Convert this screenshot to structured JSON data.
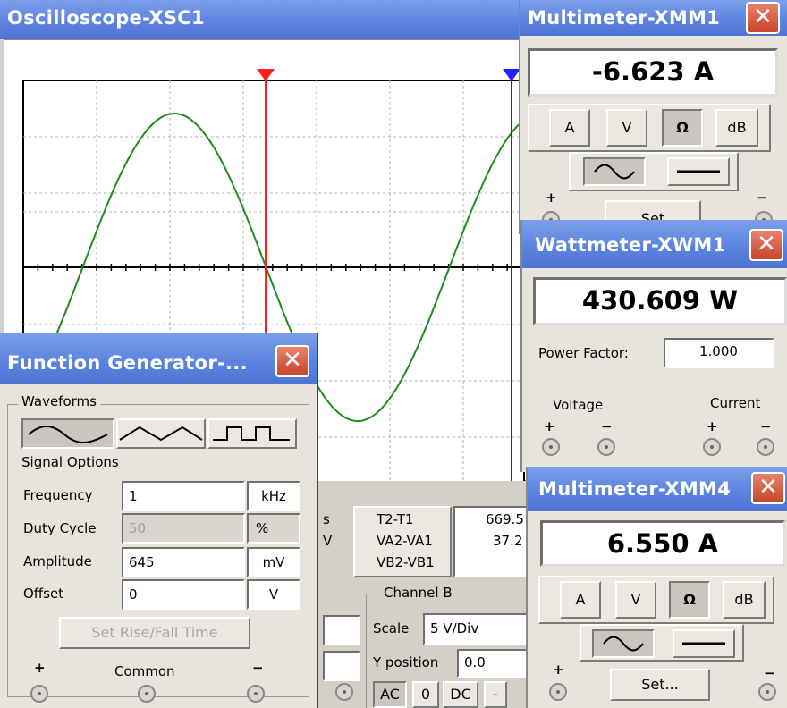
{
  "oscilloscope": {
    "title": "Oscilloscope-XSC1",
    "t2t1": {
      "label1": "T2-T1",
      "label2": "VA2-VA1",
      "label3": "VB2-VB1",
      "value1": "669.5",
      "value2": "37.2"
    },
    "partial": {
      "s": "s",
      "v": "V"
    },
    "channel_b": {
      "title": "Channel B",
      "scale_label": "Scale",
      "scale_value": "5 V/Div",
      "ypos_label": "Y position",
      "ypos_value": "0.0",
      "coupling": [
        "AC",
        "0",
        "DC",
        "-"
      ]
    }
  },
  "function_generator": {
    "title": "Function Generator-...",
    "waveforms_label": "Waveforms",
    "signal_options_label": "Signal Options",
    "frequency": {
      "label": "Frequency",
      "value": "1",
      "unit": "kHz"
    },
    "duty_cycle": {
      "label": "Duty Cycle",
      "value": "50",
      "unit": "%"
    },
    "amplitude": {
      "label": "Amplitude",
      "value": "645",
      "unit": "mV"
    },
    "offset": {
      "label": "Offset",
      "value": "0",
      "unit": "V"
    },
    "rise_fall_button": "Set Rise/Fall Time",
    "plus": "+",
    "common": "Common",
    "minus": "−"
  },
  "multimeter1": {
    "title": "Multimeter-XMM1",
    "reading": "-6.623  A",
    "modes": [
      "A",
      "V",
      "Ω",
      "dB"
    ],
    "plus": "+",
    "minus": "−",
    "set_label": "Set"
  },
  "wattmeter": {
    "title": "Wattmeter-XWM1",
    "reading": "430.609 W",
    "power_factor_label": "Power Factor:",
    "power_factor_value": "1.000",
    "voltage_label": "Voltage",
    "current_label": "Current",
    "plus": "+",
    "minus": "−"
  },
  "multimeter4": {
    "title": "Multimeter-XMM4",
    "reading": "6.550  A",
    "modes": [
      "A",
      "V",
      "Ω",
      "dB"
    ],
    "set_label": "Set...",
    "plus": "+",
    "minus": "−"
  },
  "close_glyph": "✕",
  "colors": {
    "trace": "#1e8c1e",
    "cursor1": "#ff2020",
    "cursor2": "#2020ff",
    "titlebar": "#5a82de"
  }
}
